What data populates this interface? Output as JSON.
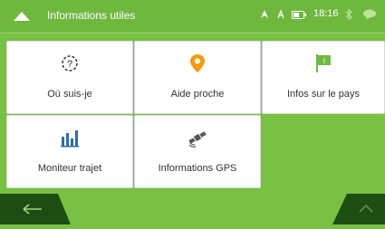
{
  "header": {
    "title": "Informations utiles",
    "time": "18:16"
  },
  "tiles": [
    {
      "label": "Où suis-je"
    },
    {
      "label": "Aide proche"
    },
    {
      "label": "Infos sur le pays"
    },
    {
      "label": "Moniteur trajet"
    },
    {
      "label": "Informations GPS"
    }
  ],
  "icons": {
    "menu": "menu-up-icon",
    "nav": "navigation-icon",
    "gps": "satellite-icon",
    "battery": "battery-icon",
    "bluetooth": "bluetooth-icon",
    "chat": "chat-icon",
    "back": "back-arrow-icon",
    "up": "chevron-up-icon"
  },
  "colors": {
    "background": "#78c143",
    "bar": "#6fb83e",
    "bottom_button": "#1e4d12",
    "accent_orange": "#f39c12",
    "accent_green": "#6dbb45",
    "icon_blue": "#2e6da4"
  }
}
